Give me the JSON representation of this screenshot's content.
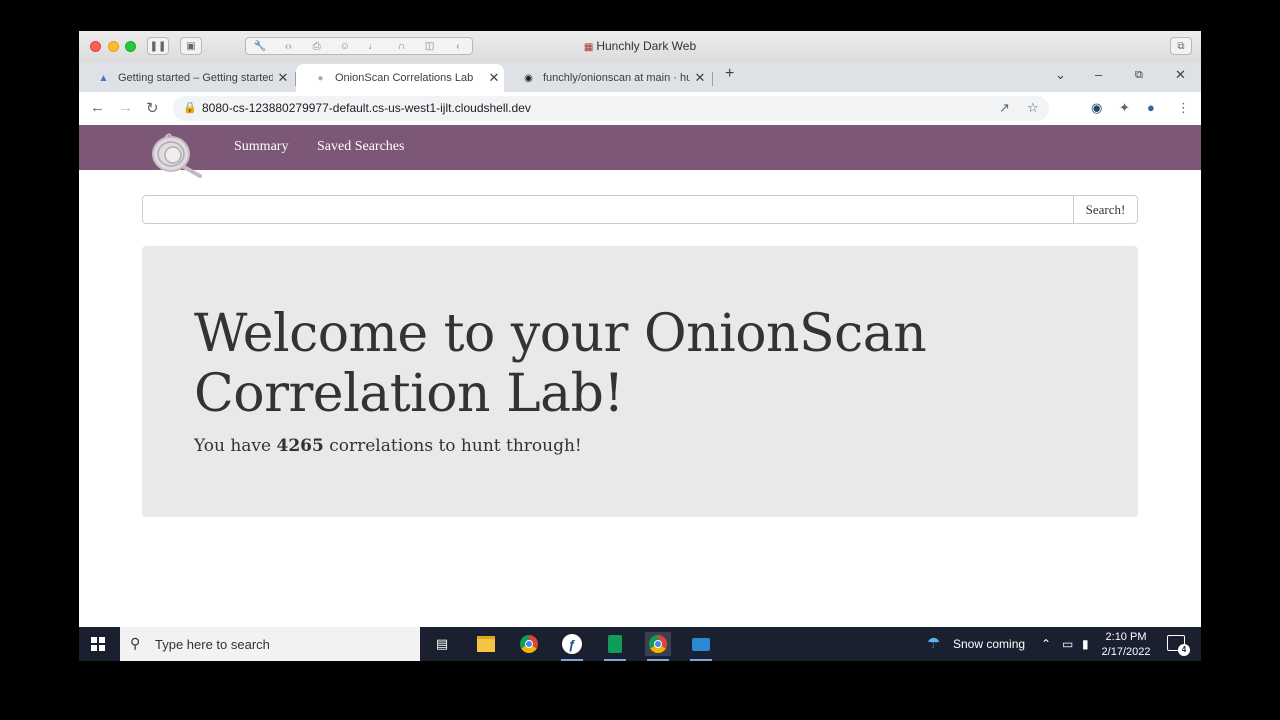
{
  "window": {
    "title": "Hunchly Dark Web",
    "icon": "hunchly-icon"
  },
  "tabs": [
    {
      "title": "Getting started – Getting started",
      "icon": "graduation-cap-icon",
      "active": false
    },
    {
      "title": "OnionScan Correlations Lab",
      "icon": "onion-icon",
      "active": true
    },
    {
      "title": "funchly/onionscan at main · hunchly",
      "icon": "github-icon",
      "active": false
    }
  ],
  "address_bar": {
    "url": "8080-cs-123880279977-default.cs-us-west1-ijlt.cloudshell.dev"
  },
  "navbar": {
    "links": [
      "Summary",
      "Saved Searches"
    ],
    "brand_color": "#7d5876"
  },
  "search": {
    "placeholder": "",
    "button_label": "Search!"
  },
  "jumbotron": {
    "heading": "Welcome to your OnionScan Correlation Lab!",
    "text_prefix": "You have ",
    "count": "4265",
    "text_suffix": " correlations to hunt through!"
  },
  "taskbar": {
    "search_placeholder": "Type here to search",
    "weather": "Snow coming",
    "time": "2:10 PM",
    "date": "2/17/2022",
    "notification_count": "4"
  }
}
